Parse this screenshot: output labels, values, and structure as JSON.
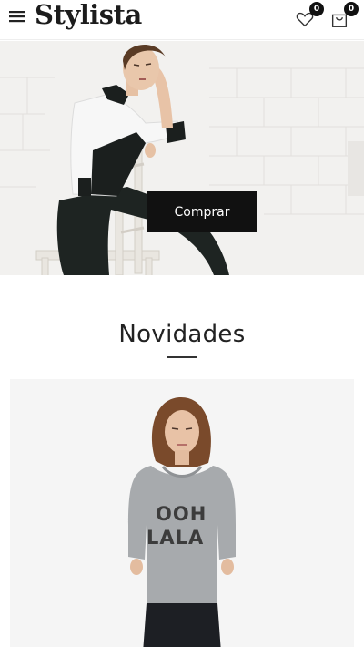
{
  "header": {
    "logo": "Stylista",
    "menu_icon": "hamburger-menu-icon",
    "wishlist_icon": "heart-icon",
    "wishlist_count": "0",
    "cart_icon": "shopping-bag-icon",
    "cart_count": "0"
  },
  "hero": {
    "button_label": "Comprar"
  },
  "section": {
    "title": "Novidades"
  },
  "product": {
    "shirt_line1": "OOH",
    "shirt_line2": "LALA"
  },
  "colors": {
    "accent": "#111111",
    "background": "#ffffff",
    "product_bg": "#f5f5f5"
  }
}
